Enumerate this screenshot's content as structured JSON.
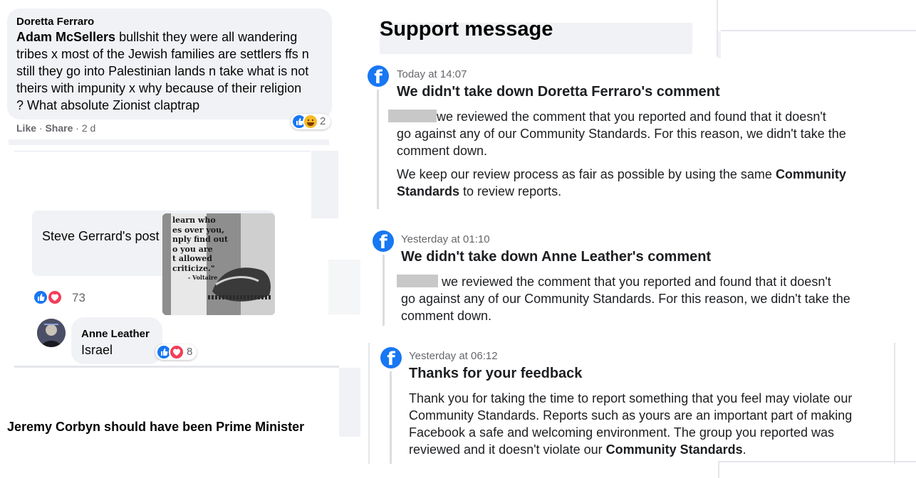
{
  "left": {
    "top_comment": {
      "author": "Doretta Ferraro",
      "mention": "Adam McSellers",
      "text_lines": [
        " bullshit they were all wandering",
        "tribes x most of the Jewish families are settlers ffs n",
        "still they go into Palestinian lands n take what is not",
        "theirs with impunity x why because of their religion",
        "? What absolute Zionist claptrap"
      ],
      "like_label": "Like",
      "share_label": "Share",
      "age": "· 2 d",
      "separator": "·",
      "reaction_count": "2"
    },
    "post": {
      "title": "Steve Gerrard's post",
      "image_text_lines": [
        "learn who",
        "es over you,",
        "nply find out",
        "o you are",
        "t allowed",
        "criticize.\"",
        "- Voltaire"
      ],
      "reaction_count": "73"
    },
    "reply": {
      "author": "Anne Leather",
      "text": "Israel",
      "reaction_count": "8"
    },
    "bottom_text": "Jeremy Corbyn should have been Prime Minister"
  },
  "right": {
    "heading": "Support message",
    "messages": [
      {
        "timestamp": "Today at 14:07",
        "title": "We didn't take down Doretta Ferraro's comment",
        "p1_lines": [
          "we reviewed the comment that you reported and found that it doesn't",
          "go against any of our Community Standards. For this reason, we didn't take the",
          "comment down."
        ],
        "p2_pre": "We keep our review process as fair as possible by using the same ",
        "p2_bold1": "Community",
        "p2_bold2": "Standards",
        "p2_post": " to review reports."
      },
      {
        "timestamp": "Yesterday at 01:10",
        "title": "We didn't take down Anne Leather's comment",
        "p1_lines": [
          " we reviewed the comment that you reported and found that it doesn't",
          "go against any of our Community Standards. For this reason, we didn't take the",
          "comment down."
        ]
      },
      {
        "timestamp": "Yesterday at 06:12",
        "title": "Thanks for your feedback",
        "p1_lines": [
          "Thank you for taking the time to report something that you feel may violate our",
          "Community Standards. Reports such as yours are an important part of making",
          "Facebook a safe and welcoming environment. The group you reported was"
        ],
        "p1_last_pre": "reviewed and it doesn't violate our ",
        "p1_last_bold": "Community Standards",
        "p1_last_post": "."
      }
    ]
  },
  "colors": {
    "facebook_blue": "#1877f2",
    "love_red": "#f33e58",
    "bubble_gray": "#f0f2f5",
    "secondary_text": "#65676b"
  },
  "icons": [
    "facebook-logo-icon",
    "like-reaction-icon",
    "love-reaction-icon",
    "haha-reaction-icon",
    "avatar"
  ]
}
